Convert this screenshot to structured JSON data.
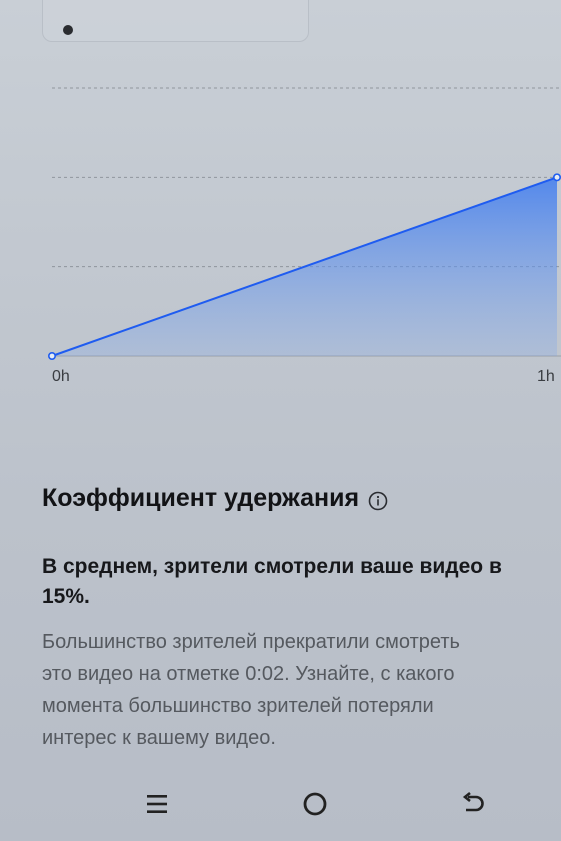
{
  "chart_data": {
    "type": "area",
    "x": [
      "0h",
      "1h"
    ],
    "series": [
      {
        "values": [
          0,
          2
        ]
      }
    ],
    "ylim": [
      0,
      3
    ],
    "grid": true,
    "colors": {
      "line": "#1f5cf0",
      "fill": "#4d86ee"
    }
  },
  "retention": {
    "title": "Коэффициент удержания",
    "summary_line1": "В среднем, зрители смотрели ваше видео в",
    "summary_line2": "15%.",
    "desc_line1": "Большинство зрителей прекратили смотреть",
    "desc_line2": "это видео на отметке 0:02. Узнайте, с какого",
    "desc_line3": "момента большинство зрителей потеряли",
    "desc_line4": "интерес к вашему видео."
  },
  "icons": {
    "info": "info-icon",
    "menu": "menu-icon",
    "home": "home-icon",
    "back": "back-icon"
  }
}
